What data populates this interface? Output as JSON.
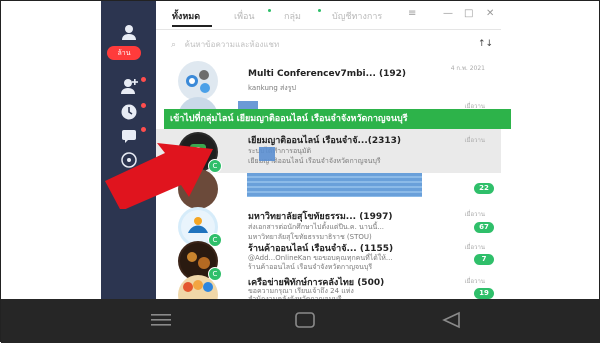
{
  "sidebar": {
    "badge": "ล้าน",
    "icons": [
      "user-icon",
      "friends-add-icon",
      "clock-icon",
      "chat-icon",
      "call-icon"
    ]
  },
  "tabs": {
    "items": [
      "ทั้งหมด",
      "เพื่อน",
      "กลุ่ม",
      "บัญชีทางการ"
    ],
    "active": 0,
    "filter_icon": "≡",
    "minimize": "—",
    "maximize": "□",
    "close": "✕"
  },
  "search": {
    "placeholder": "ค้นหาข้อความและห้องแชท",
    "sort_icon": "↑↓"
  },
  "banner": {
    "text": "เข้าไปที่กลุ่มไลน์ เยียมญาติออนไลน์ เรือนจำจังหวัดกาญจนบุรี"
  },
  "chats": [
    {
      "name": "Multi Conferencev7mbi... (192)",
      "sub": "kankung ส่งรูป",
      "date": "4 ก.พ. 2021",
      "badge": ""
    },
    {
      "name": "",
      "sub": "",
      "date": "เมื่อวาน",
      "badge": ""
    },
    {
      "name": "เยียมญาติออนไลน์ เรือนจำจั...(2313)",
      "sub": "ระบบได้ทำการอนุมัติ",
      "sub2": "เยียมญาติออนไลน์ เรือนจำจังหวัดกาญจนบุรี",
      "date": "เมื่อวาน",
      "badge": ""
    },
    {
      "name": "",
      "sub": "",
      "date": "",
      "badge": "22"
    },
    {
      "name": "มหาวิทยาลัยสุโขทัยธรรม... (1997)",
      "sub": "ส่งเอกสารต่อนักศึกษาไปตั้งแต่ปีน.ค. นานนี้...",
      "sub2": "มหาวิทยาลัยสุโขทัยธรรมาธิราช (STOU)",
      "date": "เมื่อวาน",
      "badge": "67"
    },
    {
      "name": "ร้านค้าออนไลน์ เรือนจำจั... (1155)",
      "sub": "@Add...OnlineKan ขอขอบคุณทุกคนที่ได้ให้...",
      "sub2": "ร้านค้าออนไลน์ เรือนจำจังหวัดกาญจนบุรี",
      "date": "เมื่อวาน",
      "badge": "7"
    },
    {
      "name": "เครือข่ายพิทักษ์การคลังไทย (500)",
      "sub": "ขอความกรุณา เรียนเจ้าถึง 24 แห่ง",
      "sub2": "สำนักงานคลังจังหวัดกาญจนบุรี",
      "date": "เมื่อวาน",
      "badge": "19"
    }
  ],
  "navbar": {
    "icons": [
      "menu-icon",
      "home-icon",
      "back-icon"
    ]
  },
  "colors": {
    "sidebar": "#2c3550",
    "green": "#2fbf6a",
    "banner": "#2db34a",
    "arrow": "#e0141e",
    "blue": "#5a96d6"
  }
}
